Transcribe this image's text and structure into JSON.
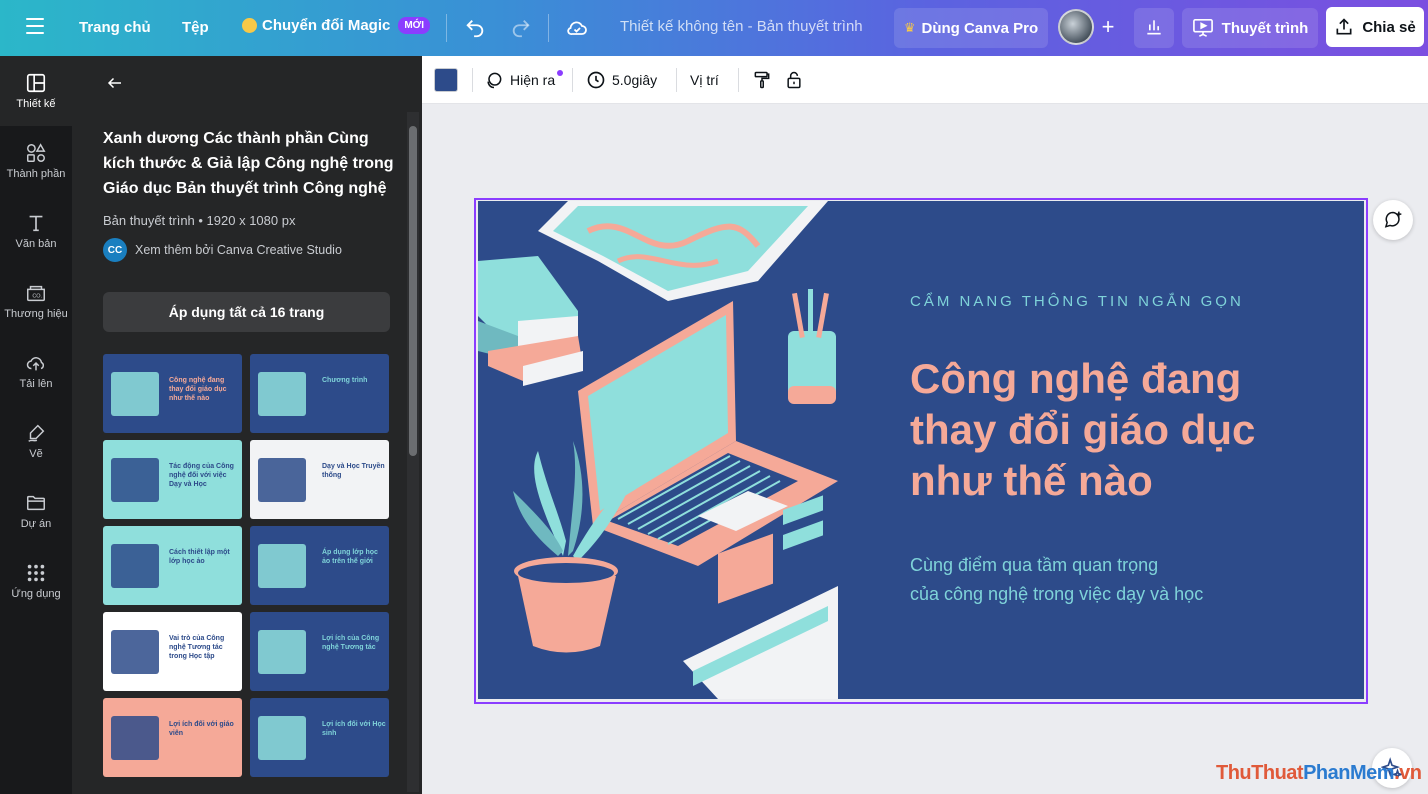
{
  "topbar": {
    "home": "Trang chủ",
    "file": "Tệp",
    "magic": "Chuyển đổi Magic",
    "new_badge": "MỚI",
    "doc_title": "Thiết kế không tên - Bản thuyết trình",
    "pro": "Dùng Canva Pro",
    "present": "Thuyết trình",
    "share": "Chia sẻ"
  },
  "rail": {
    "items": [
      {
        "label": "Thiết kế",
        "icon": "layout-icon"
      },
      {
        "label": "Thành phần",
        "icon": "shapes-icon"
      },
      {
        "label": "Văn bản",
        "icon": "text-icon"
      },
      {
        "label": "Thương hiệu",
        "icon": "brand-icon"
      },
      {
        "label": "Tải lên",
        "icon": "upload-cloud-icon"
      },
      {
        "label": "Vẽ",
        "icon": "draw-icon"
      },
      {
        "label": "Dự án",
        "icon": "folder-icon"
      },
      {
        "label": "Ứng dụng",
        "icon": "apps-grid-icon"
      }
    ]
  },
  "panel": {
    "title": "Xanh dương Các thành phần Cùng kích thước & Giả lập Công nghệ trong Giáo dục Bản thuyết trình Công nghệ",
    "meta": "Bản thuyết trình • 1920 x 1080 px",
    "author_logo": "CC",
    "author": "Xem thêm bởi Canva Creative Studio",
    "apply": "Áp dụng tất cả 16 trang",
    "thumbs": [
      {
        "text": "Công nghệ đang thay đổi giáo dục như thế nào",
        "bg": "#2d4b8a",
        "fg": "#f5a998"
      },
      {
        "text": "Chương trình",
        "bg": "#2d4b8a",
        "fg": "#7fd3d9"
      },
      {
        "text": "Tác động của Công nghệ đối với việc Dạy và Học",
        "bg": "#8fdfdc",
        "fg": "#2d4b8a"
      },
      {
        "text": "Dạy và Học Truyền thống",
        "bg": "#f2f3f5",
        "fg": "#2d4b8a"
      },
      {
        "text": "Cách thiết lập một lớp học ảo",
        "bg": "#8fdfdc",
        "fg": "#2d4b8a"
      },
      {
        "text": "Áp dụng lớp học ảo trên thế giới",
        "bg": "#2d4b8a",
        "fg": "#7fd3d9"
      },
      {
        "text": "Vai trò của Công nghệ Tương tác trong Học tập",
        "bg": "#ffffff",
        "fg": "#2d4b8a"
      },
      {
        "text": "Lợi ích của Công nghệ Tương tác",
        "bg": "#2d4b8a",
        "fg": "#7fd3d9"
      },
      {
        "text": "Lợi ích đối với giáo viên",
        "bg": "#f5a998",
        "fg": "#2d4b8a"
      },
      {
        "text": "Lợi ích đối với Học sinh",
        "bg": "#2d4b8a",
        "fg": "#7fd3d9"
      }
    ]
  },
  "toolbar": {
    "appear": "Hiện ra",
    "duration": "5.0giây",
    "position": "Vị trí"
  },
  "slide": {
    "kicker": "CẨM NANG THÔNG TIN NGẮN GỌN",
    "title": "Công nghệ đang thay đổi giáo dục như thế nào",
    "subtitle_line1": "Cùng điểm qua tầm quan trọng",
    "subtitle_line2": "của công nghệ trong việc dạy và học"
  },
  "watermark": {
    "part1": "ThuThuat",
    "part2": "PhanMem",
    "part3": ".vn"
  },
  "colors": {
    "slide_bg": "#2d4b8a",
    "accent_pink": "#f5a998",
    "accent_teal": "#7fd3d9",
    "selection": "#8b3dff"
  }
}
